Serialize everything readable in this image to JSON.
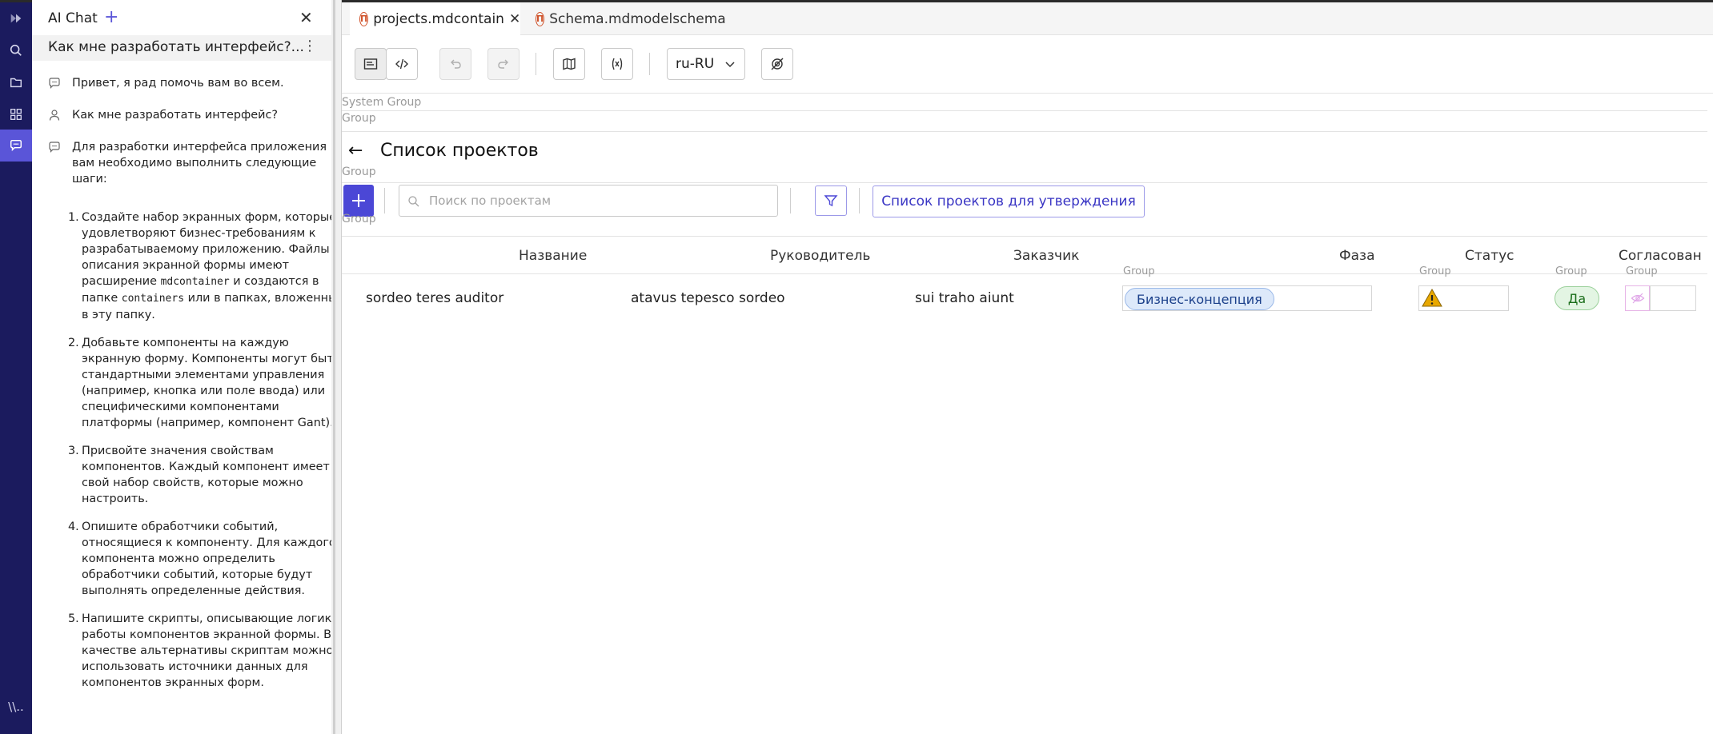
{
  "activity_bar": {
    "items": [
      "logo-icon",
      "search-icon",
      "folder-icon",
      "apps-icon",
      "chat-icon",
      "terminal-icon"
    ],
    "active": "chat-icon",
    "bottom_label": "\\\\.."
  },
  "chat": {
    "title": "AI Chat",
    "conversation_title": "Как мне разработать интерфейс?...",
    "messages": [
      {
        "role": "assistant",
        "text": "Привет, я рад помочь вам во всем."
      },
      {
        "role": "user",
        "text": "Как мне разработать интерфейс?"
      },
      {
        "role": "assistant",
        "text": "Для разработки интерфейса приложения вам необходимо выполнить следующие шаги:"
      }
    ],
    "steps": [
      {
        "num": "1.",
        "parts": [
          "Создайте набор экранных форм, которые удовлетворяют бизнес-требованиям к разрабатываемому приложению. Файлы описания экранной формы имеют расширение ",
          "mdcontainer",
          " и создаются в папке ",
          "containers",
          " или в папках, вложенных в эту папку."
        ]
      },
      {
        "num": "2.",
        "text": "Добавьте компоненты на каждую экранную форму. Компоненты могут быть стандартными элементами управления (например, кнопка или поле ввода) или специфическими компонентами платформы (например, компонент Gant)."
      },
      {
        "num": "3.",
        "text": "Присвойте значения свойствам компонентов. Каждый компонент имеет свой набор свойств, которые можно настроить."
      },
      {
        "num": "4.",
        "text": "Опишите обработчики событий, относящиеся к компоненту. Для каждого компонента можно определить обработчики событий, которые будут выполнять определенные действия."
      },
      {
        "num": "5.",
        "text": "Напишите скрипты, описывающие логику работы компонентов экранной формы. В качестве альтернативы скриптам можно использовать источники данных для компонентов экранных форм."
      }
    ]
  },
  "tabs": [
    {
      "label": "projects.mdcontain",
      "badge": "П",
      "active": true
    },
    {
      "label": "Schema.mdmodelschema",
      "badge": "П",
      "active": false
    }
  ],
  "toolbar": {
    "locale": "ru-RU"
  },
  "form": {
    "group_labels": {
      "system_group": "System Group",
      "group": "Group"
    },
    "title": "Список проектов",
    "search_placeholder": "Поиск по проектам",
    "approve_button": "Список проектов для утверждения",
    "columns": [
      "Название",
      "Руководитель",
      "Заказчик",
      "Фаза",
      "Статус",
      "Согласован"
    ],
    "rows": [
      {
        "name": "sordeo teres auditor",
        "manager": "atavus tepesco sordeo",
        "customer": "sui traho aiunt",
        "phase": "Бизнес-концепция",
        "status_icon": "warning-icon",
        "approved": "Да"
      }
    ]
  },
  "colors": {
    "activity_bg": "#1b1b5e",
    "accent": "#4b47d6",
    "tab_badge": "#d0532b",
    "warning": "#e8a800"
  }
}
